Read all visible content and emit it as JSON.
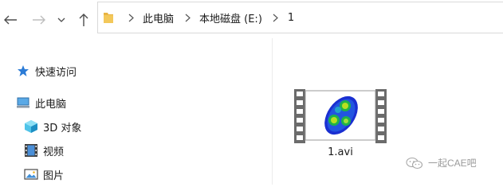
{
  "toolbar": {
    "back_icon": "arrow-left-icon",
    "forward_icon": "arrow-right-icon",
    "recent_icon": "chevron-down-icon",
    "up_icon": "arrow-up-icon"
  },
  "address": {
    "folder_icon": "folder-icon",
    "crumbs": [
      "此电脑",
      "本地磁盘 (E:)",
      "1"
    ]
  },
  "navpane": {
    "items": [
      {
        "label": "快速访问",
        "icon": "star-icon"
      },
      {
        "label": "此电脑",
        "icon": "computer-icon"
      },
      {
        "label": "3D 对象",
        "icon": "cube-icon"
      },
      {
        "label": "视频",
        "icon": "film-icon"
      },
      {
        "label": "图片",
        "icon": "picture-icon"
      }
    ]
  },
  "files": [
    {
      "name": "1.avi",
      "icon": "video-file-icon"
    }
  ],
  "watermark": {
    "text": "一起CAE吧",
    "icon": "wechat-icon"
  },
  "colors": {
    "accent": "#1e6fd9",
    "folder": "#e8b342",
    "film": "#6b6b6b"
  }
}
